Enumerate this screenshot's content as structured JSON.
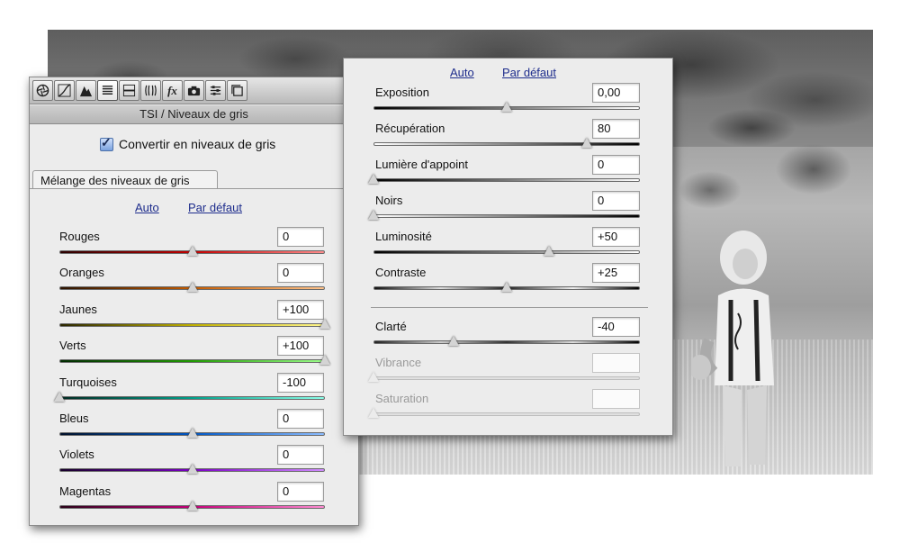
{
  "left_panel": {
    "title": "TSI / Niveaux de gris",
    "convert_label": "Convertir en niveaux de gris",
    "tab_label": "Mélange des niveaux de gris",
    "auto_label": "Auto",
    "default_label": "Par défaut",
    "toolbar_icons": [
      "aperture-icon",
      "tone-curve-icon",
      "detail-icon",
      "hsl-icon",
      "split-toning-icon",
      "lens-corrections-icon",
      "effects-icon",
      "camera-calibration-icon",
      "presets-icon",
      "snapshots-icon"
    ],
    "sliders": [
      {
        "label": "Rouges",
        "value": "0",
        "position": 0.5,
        "track": "linear-gradient(90deg,#2a0000,#c40000 50%,#ff8b8b)"
      },
      {
        "label": "Oranges",
        "value": "0",
        "position": 0.5,
        "track": "linear-gradient(90deg,#2a1200,#c45b00 50%,#ffc38b)"
      },
      {
        "label": "Jaunes",
        "value": "+100",
        "position": 1.0,
        "track": "linear-gradient(90deg,#2a2600,#c0b000 50%,#fff68b)"
      },
      {
        "label": "Verts",
        "value": "+100",
        "position": 1.0,
        "track": "linear-gradient(90deg,#002a00,#1f9b00 50%,#9cff8b)"
      },
      {
        "label": "Turquoises",
        "value": "-100",
        "position": 0.0,
        "track": "linear-gradient(90deg,#002a22,#00a08a 50%,#8bffe9)"
      },
      {
        "label": "Bleus",
        "value": "0",
        "position": 0.5,
        "track": "linear-gradient(90deg,#00112a,#0057c4 50%,#8bbcff)"
      },
      {
        "label": "Violets",
        "value": "0",
        "position": 0.5,
        "track": "linear-gradient(90deg,#17002a,#7a00c4 50%,#d08bff)"
      },
      {
        "label": "Magentas",
        "value": "0",
        "position": 0.5,
        "track": "linear-gradient(90deg,#2a0018,#c4007a 50%,#ff8bd2)"
      }
    ]
  },
  "right_panel": {
    "auto_label": "Auto",
    "default_label": "Par défaut",
    "sliders": [
      {
        "label": "Exposition",
        "value": "0,00",
        "position": 0.5,
        "disabled": false,
        "track": "linear-gradient(90deg,#000,#777 50%,#fff)"
      },
      {
        "label": "Récupération",
        "value": "80",
        "position": 0.8,
        "disabled": false,
        "track": "linear-gradient(90deg,#fff,#888 50%,#000)"
      },
      {
        "label": "Lumière d'appoint",
        "value": "0",
        "position": 0.0,
        "disabled": false,
        "track": "linear-gradient(90deg,#000,#777 50%,#fff)"
      },
      {
        "label": "Noirs",
        "value": "0",
        "position": 0.0,
        "disabled": false,
        "track": "linear-gradient(90deg,#fff,#888 50%,#000)"
      },
      {
        "label": "Luminosité",
        "value": "+50",
        "position": 0.66,
        "disabled": false,
        "track": "linear-gradient(90deg,#000,#777 50%,#fff)"
      },
      {
        "label": "Contraste",
        "value": "+25",
        "position": 0.5,
        "disabled": false,
        "track": "linear-gradient(90deg,#111,#ddd 25%,#222 50%,#eee 75%,#000)"
      },
      {
        "label": "Clarté",
        "value": "-40",
        "position": 0.3,
        "disabled": false,
        "track": "linear-gradient(90deg,#222,#ccc 25%,#333 50%,#ddd 75%,#000)"
      },
      {
        "label": "Vibrance",
        "value": "",
        "position": 0.0,
        "disabled": true,
        "track": "#ddd"
      },
      {
        "label": "Saturation",
        "value": "",
        "position": 0.0,
        "disabled": true,
        "track": "#ddd"
      }
    ]
  }
}
